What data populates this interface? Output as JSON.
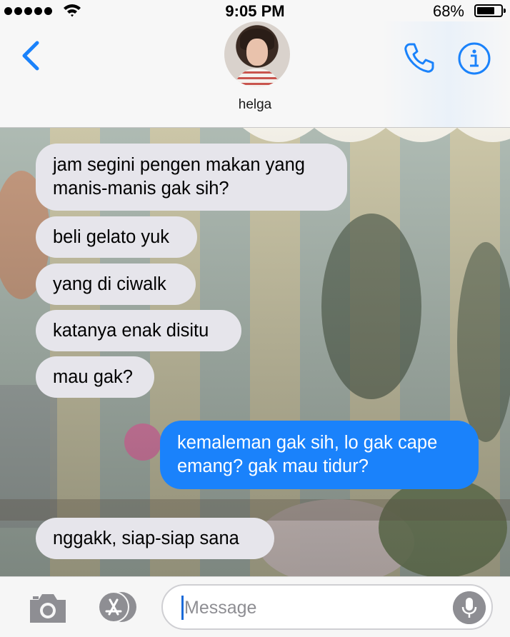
{
  "status_bar": {
    "time": "9:05 PM",
    "battery_percent_label": "68%",
    "battery_level": 0.68,
    "signal_dots": 5
  },
  "header": {
    "contact_name": "helga",
    "back_icon": "chevron-left-icon",
    "phone_icon": "phone-icon",
    "info_icon": "info-icon"
  },
  "messages": [
    {
      "direction": "incoming",
      "text": "jam segini pengen makan yang\nmanis-manis gak sih?"
    },
    {
      "direction": "incoming",
      "text": "beli gelato yuk"
    },
    {
      "direction": "incoming",
      "text": "yang di ciwalk"
    },
    {
      "direction": "incoming",
      "text": "katanya enak disitu"
    },
    {
      "direction": "incoming",
      "text": "mau gak?"
    },
    {
      "direction": "outgoing",
      "text": "kemaleman gak sih, lo gak cape\nemang? gak mau tidur?"
    },
    {
      "direction": "incoming",
      "text": "nggakk, siap-siap sana"
    }
  ],
  "input_bar": {
    "placeholder": "Message",
    "value": "",
    "camera_icon": "camera-icon",
    "apps_icon": "app-store-icon",
    "mic_icon": "microphone-icon"
  },
  "colors": {
    "accent": "#1a82fb",
    "incoming_bubble": "#e6e5eb",
    "outgoing_bubble": "#1a82fb"
  }
}
